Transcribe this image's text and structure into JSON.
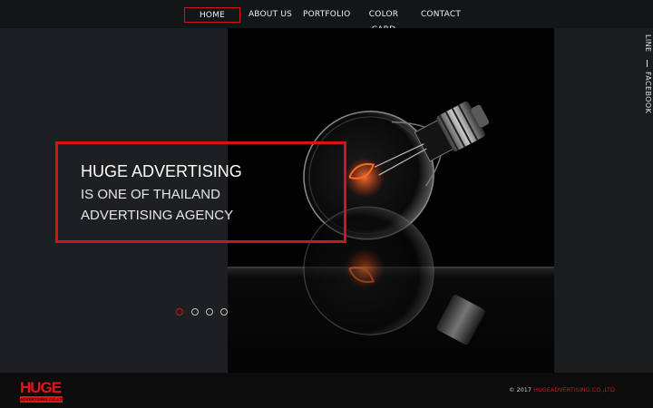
{
  "nav": {
    "items": [
      {
        "label": "HOME",
        "active": true
      },
      {
        "label": "ABOUT US",
        "active": false
      },
      {
        "label": "PORTFOLIO",
        "active": false
      },
      {
        "label": "COLOR CARD",
        "active": false
      },
      {
        "label": "CONTACT",
        "active": false
      }
    ]
  },
  "hero": {
    "image": "light-bulb-photo",
    "headline": {
      "title": "HUGE ADVERTISING",
      "line1": "IS ONE OF THAILAND",
      "line2": "ADVERTISING AGENCY"
    },
    "slides": {
      "count": 4,
      "active_index": 0
    }
  },
  "social": {
    "line": "LINE",
    "facebook": "FACEBOOK"
  },
  "footer": {
    "logo_main": "HUGE",
    "logo_sub": "ADVERTISING CO.,LTD",
    "copyright_prefix": "© 2017 ",
    "copyright_brand": "HUGEADVERTISING CO.,LTD"
  },
  "colors": {
    "accent": "#d0161b",
    "background": "#1b1c1e",
    "footer": "#0c0c0d"
  }
}
